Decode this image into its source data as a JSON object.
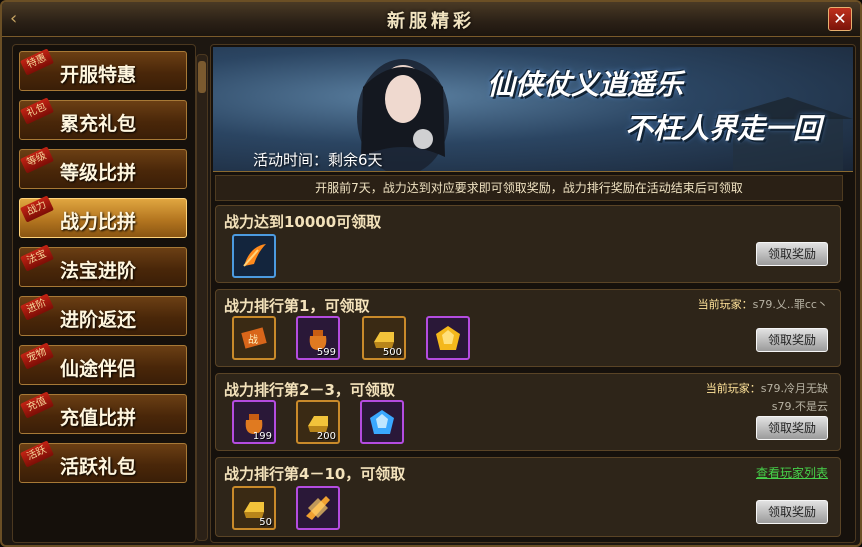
{
  "window": {
    "title": "新服精彩"
  },
  "sidebar": {
    "items": [
      {
        "tag": "特惠",
        "label": "开服特惠"
      },
      {
        "tag": "礼包",
        "label": "累充礼包"
      },
      {
        "tag": "等级",
        "label": "等级比拼"
      },
      {
        "tag": "战力",
        "label": "战力比拼"
      },
      {
        "tag": "法宝",
        "label": "法宝进阶"
      },
      {
        "tag": "进阶",
        "label": "进阶返还"
      },
      {
        "tag": "宠物",
        "label": "仙途伴侣"
      },
      {
        "tag": "充值",
        "label": "充值比拼"
      },
      {
        "tag": "活跃",
        "label": "活跃礼包"
      }
    ],
    "active_index": 3
  },
  "banner": {
    "slogan_line1": "仙侠仗义逍遥乐",
    "slogan_line2": "不枉人界走一回",
    "time_text": "活动时间：剩余6天"
  },
  "notice": "开服前7天，战力达到对应要求即可领取奖励，战力排行奖励在活动结束后可领取",
  "panels": [
    {
      "title": "战力达到10000可领取",
      "button": "领取奖励",
      "items": [
        {
          "icon": "phoenix-feather-icon",
          "count": ""
        }
      ]
    },
    {
      "title": "战力排行第1，可领取",
      "current_label": "当前玩家：",
      "players": [
        "s79.乂..罪cc丶"
      ],
      "button": "领取奖励",
      "items": [
        {
          "icon": "battle-power-scroll-icon",
          "count": ""
        },
        {
          "icon": "treasure-bag-icon",
          "count": "599"
        },
        {
          "icon": "gold-ingot-icon",
          "count": "500"
        },
        {
          "icon": "gold-gem-icon",
          "count": ""
        }
      ]
    },
    {
      "title": "战力排行第2－3，可领取",
      "current_label": "当前玩家：",
      "players": [
        "s79.冷月无缺",
        "s79.不是云"
      ],
      "button": "领取奖励",
      "items": [
        {
          "icon": "treasure-bag-icon",
          "count": "199"
        },
        {
          "icon": "gold-ingot-icon",
          "count": "200"
        },
        {
          "icon": "blue-gem-icon",
          "count": ""
        }
      ]
    },
    {
      "title": "战力排行第4－10，可领取",
      "link": "查看玩家列表",
      "button": "领取奖励",
      "items": [
        {
          "icon": "gold-ingot-icon",
          "count": "50"
        },
        {
          "icon": "orange-crystal-icon",
          "count": ""
        }
      ]
    }
  ]
}
